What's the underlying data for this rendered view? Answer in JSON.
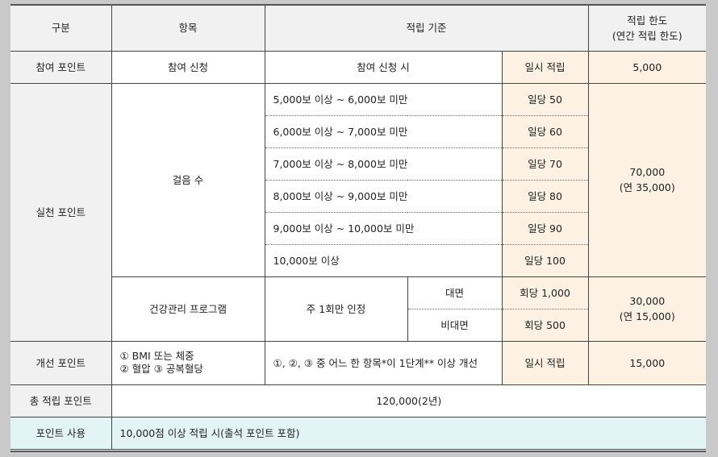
{
  "header": {
    "category": "구분",
    "item": "항목",
    "criteria": "적립 기준",
    "limit_line1": "적립 한도",
    "limit_line2": "(연간 적립 한도)"
  },
  "participation": {
    "category": "참여 포인트",
    "item": "참여 신청",
    "criteria": "참여 신청 시",
    "rate": "일시 적립",
    "limit": "5,000"
  },
  "practice": {
    "category": "실천 포인트",
    "steps_item": "걸음 수",
    "steps": [
      {
        "criteria": "5,000보 이상 ~ 6,000보 미만",
        "rate": "일당 50"
      },
      {
        "criteria": "6,000보 이상 ~ 7,000보 미만",
        "rate": "일당 60"
      },
      {
        "criteria": "7,000보 이상 ~ 8,000보 미만",
        "rate": "일당 70"
      },
      {
        "criteria": "8,000보 이상 ~ 9,000보 미만",
        "rate": "일당 80"
      },
      {
        "criteria": "9,000보 이상 ~ 10,000보 미만",
        "rate": "일당 90"
      },
      {
        "criteria": "10,000보 이상",
        "rate": "일당 100"
      }
    ],
    "steps_limit_line1": "70,000",
    "steps_limit_line2": "(연 35,000)",
    "program_item": "건강관리 프로그램",
    "program_criteria": "주 1회만 인정",
    "program_rows": [
      {
        "type": "대면",
        "rate": "회당 1,000"
      },
      {
        "type": "비대면",
        "rate": "회당 500"
      }
    ],
    "program_limit_line1": "30,000",
    "program_limit_line2": "(연 15,000)"
  },
  "improvement": {
    "category": "개선 포인트",
    "item_line1": "① BMI 또는 체중",
    "item_line2": "② 혈압 ③ 공복혈당",
    "criteria": "①, ②, ③ 중 어느 한 항목*이 1단계** 이상 개선",
    "rate": "일시 적립",
    "limit": "15,000"
  },
  "total": {
    "category": "총 적립 포인트",
    "value": "120,000(2년)"
  },
  "usage": {
    "category": "포인트 사용",
    "value": "10,000점 이상 적립 시(출석 포인트 포함)"
  }
}
